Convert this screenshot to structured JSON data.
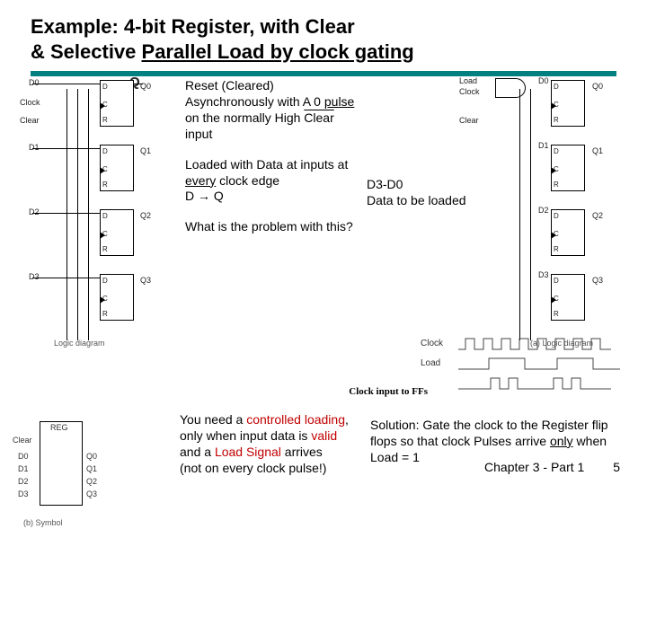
{
  "title": {
    "line1_a": "Example: 4-bit Register, with Clear",
    "line2_a": "& Selective ",
    "line2_b": "Parallel Load",
    "line2_c": " by clock gating"
  },
  "leftDiagram": {
    "clock": "Clock",
    "clear": "Clear",
    "Q_big": "Q",
    "ff_labels": {
      "D": "D",
      "C": "C",
      "R": "R"
    },
    "inputs": [
      "D0",
      "D1",
      "D2",
      "D3"
    ],
    "outputs": [
      "Q0",
      "Q1",
      "Q2",
      "Q3"
    ],
    "caption": "Logic diagram"
  },
  "rightDiagram": {
    "load": "Load",
    "clock": "Clock",
    "clear": "Clear",
    "ff_labels": {
      "D": "D",
      "C": "C",
      "R": "R"
    },
    "inputs": [
      "D0",
      "D1",
      "D2",
      "D3"
    ],
    "outputs": [
      "Q0",
      "Q1",
      "Q2",
      "Q3"
    ],
    "caption": "(a) Logic diagram"
  },
  "mid": {
    "p1_a": "Reset (Cleared) Asynchronously with A 0 ",
    "p1_b": "pulse",
    "p1_c": " on the normally High ",
    "p1_d": "Clear",
    "p1_e": " input",
    "p2_a": "Loaded with Data at inputs at ",
    "p2_b": "every",
    "p2_c": " clock edge",
    "p2_d": "D",
    "p2_e": "→",
    "p2_f": "Q",
    "p3": "What is the problem with this?"
  },
  "dataLabel": {
    "l1": "D3-D0",
    "l2": "Data to be loaded"
  },
  "timing": {
    "rows": [
      "Clock",
      "Load",
      "Clock input to FFs"
    ],
    "clockFFLabel": "Clock input to FFs"
  },
  "bottomLeft": {
    "a": "You need a ",
    "b": "controlled loading",
    "c": ", only when input data is ",
    "d": "valid",
    "e": " and a ",
    "f": "Load Signal",
    "g": " arrives",
    "h": "(not on every clock pulse!)"
  },
  "bottomRight": {
    "a": "Solution: Gate the clock to the Register flip flops so that clock Pulses arrive ",
    "b": "only",
    "c": " when Load = 1"
  },
  "symbol": {
    "title": "REG",
    "pins_left": [
      "Clear",
      "D0",
      "D1",
      "D2",
      "D3"
    ],
    "pins_right": [
      "Q0",
      "Q1",
      "Q2",
      "Q3"
    ],
    "caption": "(b) Symbol"
  },
  "footer": {
    "chapter": "Chapter 3 - Part 1",
    "page": "5"
  }
}
